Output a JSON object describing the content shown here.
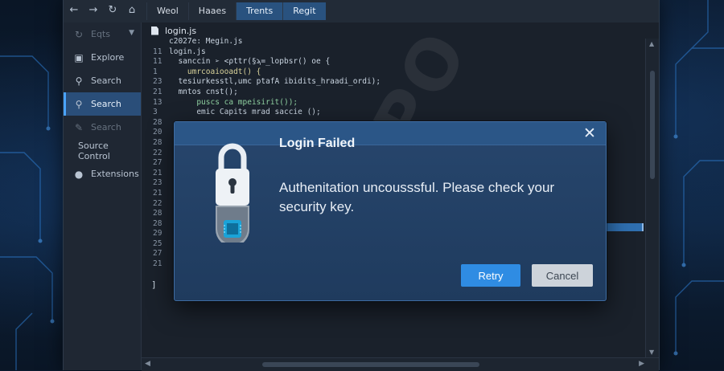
{
  "nav": {
    "back": "←",
    "forward": "→",
    "refresh": "↻",
    "home": "⌂"
  },
  "menus": [
    {
      "label": "Weol",
      "active": false
    },
    {
      "label": "Haaes",
      "active": false
    },
    {
      "label": "Trents",
      "active": true
    },
    {
      "label": "Regit",
      "active": true
    }
  ],
  "sidebar": {
    "items": [
      {
        "label": "Eqts",
        "icon": "refresh-icon",
        "chevron": "▼",
        "state": "dim"
      },
      {
        "label": "Explore",
        "icon": "explorer-icon",
        "state": "normal"
      },
      {
        "label": "Search",
        "icon": "search-icon",
        "state": "normal"
      },
      {
        "label": "Search",
        "icon": "search-icon",
        "state": "active"
      },
      {
        "label": "Search",
        "icon": "edit-icon",
        "state": "dim"
      },
      {
        "label": "Source Control",
        "icon": "",
        "state": "normal"
      },
      {
        "label": "Extensions",
        "icon": "location-icon",
        "state": "normal"
      }
    ]
  },
  "editor": {
    "filename": "login.js",
    "lines": [
      {
        "n": "",
        "t": "c2027e: Megin.js",
        "c": ""
      },
      {
        "n": "11",
        "t": "login.js",
        "c": ""
      },
      {
        "n": "11",
        "t": "  sanccin ➢ <ρttr(§ϡ=_lopbsr() oe {",
        "c": ""
      },
      {
        "n": "1",
        "t": "    umrcoaiooadt() {",
        "c": "y"
      },
      {
        "n": "23",
        "t": "  tesiurkesstl,umc ptafA ibidits_hraadi_ordi);",
        "c": ""
      },
      {
        "n": "21",
        "t": "  mntos cnst();",
        "c": ""
      },
      {
        "n": "13",
        "t": "      puscs ca mpeisirit());",
        "c": "g"
      },
      {
        "n": "3",
        "t": "      emic Capits mrad saccie ();",
        "c": ""
      },
      {
        "n": "28",
        "t": "",
        "c": ""
      },
      {
        "n": "20",
        "t": "",
        "c": ""
      },
      {
        "n": "28",
        "t": "",
        "c": ""
      },
      {
        "n": "22",
        "t": "",
        "c": ""
      },
      {
        "n": "27",
        "t": "",
        "c": ""
      },
      {
        "n": "21",
        "t": "",
        "c": ""
      },
      {
        "n": "23",
        "t": "",
        "c": ""
      },
      {
        "n": "21",
        "t": "",
        "c": ""
      },
      {
        "n": "22",
        "t": "",
        "c": ""
      },
      {
        "n": "28",
        "t": "",
        "c": ""
      },
      {
        "n": "28",
        "t": "",
        "c": ""
      },
      {
        "n": "29",
        "t": "",
        "c": ""
      },
      {
        "n": "25",
        "t": "",
        "c": ""
      },
      {
        "n": "27",
        "t": "",
        "c": ""
      },
      {
        "n": "21",
        "t": "",
        "c": ""
      }
    ],
    "closing_bracket": "]"
  },
  "watermark": "SRRPO",
  "dialog": {
    "title": "Login Failed",
    "message": "Authenitation uncousssful. Please check your security key.",
    "retry_label": "Retry",
    "cancel_label": "Cancel",
    "close_glyph": "✕"
  },
  "colors": {
    "accent": "#2f8ce3",
    "dialog_bg": "#27466d",
    "active_menu": "#29527f"
  }
}
